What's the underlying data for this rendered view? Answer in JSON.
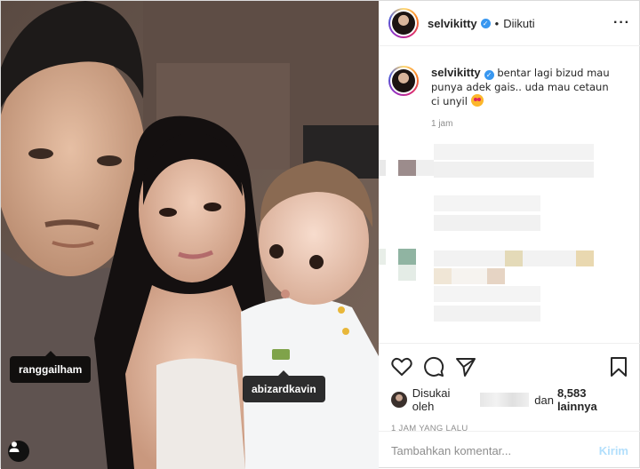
{
  "post": {
    "tags": [
      {
        "username": "ranggailham"
      },
      {
        "username": "abizardkavin"
      }
    ]
  },
  "header": {
    "username": "selvikitty",
    "separator": "•",
    "follow_status": "Diikuti",
    "more_icon": "more-horizontal-icon"
  },
  "caption": {
    "username": "selvikitty",
    "text": "bentar lagi bizud mau punya adek gais.. uda mau cetaun ci unyil",
    "emoji": "star-struck-emoji",
    "time": "1 jam"
  },
  "actions": {
    "icons": [
      "heart-icon",
      "comment-icon",
      "share-icon",
      "bookmark-icon"
    ],
    "likes_prefix": "Disukai oleh",
    "likes_connector": "dan",
    "likes_count": "8,583 lainnya",
    "timestamp": "1 JAM YANG LALU"
  },
  "comment_input": {
    "placeholder": "Tambahkan komentar...",
    "submit_label": "Kirim"
  },
  "colors": {
    "verified_blue": "#3897f0",
    "muted_text": "#8e8e8e",
    "kirim_disabled": "#b2dffc"
  }
}
